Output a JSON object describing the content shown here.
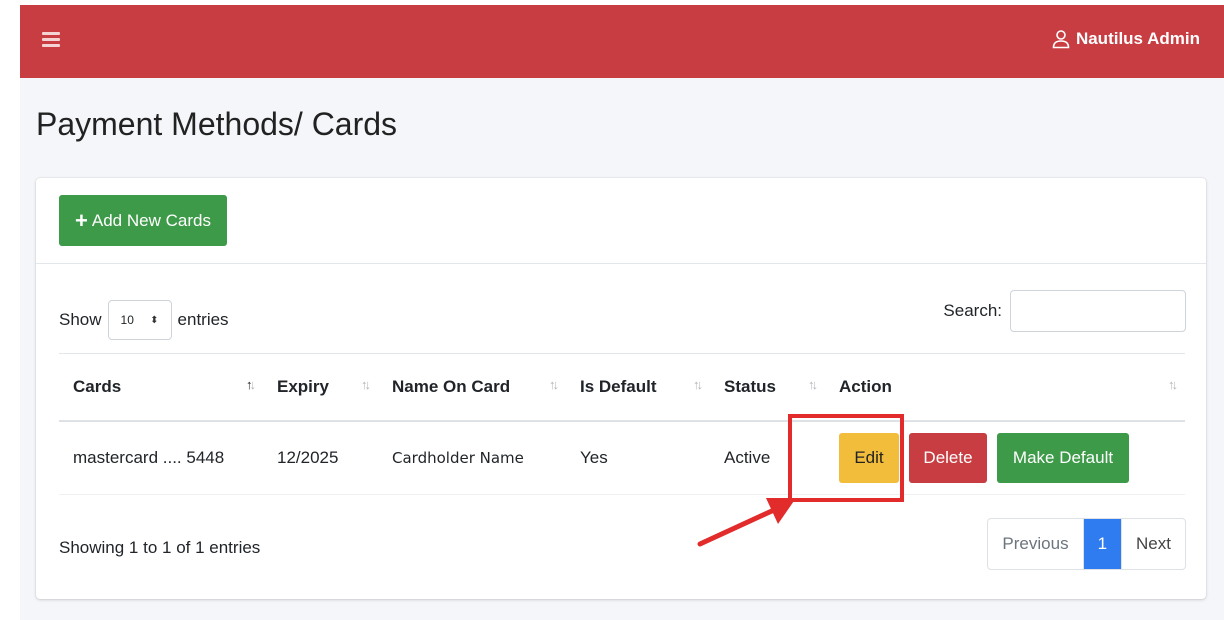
{
  "header": {
    "user_name": "Nautilus Admin",
    "bar_color": "#c73d42"
  },
  "page": {
    "title": "Payment Methods/ Cards"
  },
  "toolbar": {
    "add_label": "Add New Cards",
    "add_icon": "plus-icon"
  },
  "length": {
    "prefix": "Show",
    "value": "10",
    "suffix": "entries"
  },
  "search": {
    "label": "Search:",
    "value": ""
  },
  "table": {
    "columns": [
      "Cards",
      "Expiry",
      "Name On Card",
      "Is Default",
      "Status",
      "Action"
    ],
    "rows": [
      {
        "card": "mastercard .... 5448",
        "expiry": "12/2025",
        "name": "Cardholder Name",
        "is_default": "Yes",
        "status": "Active",
        "actions": {
          "edit": "Edit",
          "delete": "Delete",
          "make_default": "Make Default"
        }
      }
    ]
  },
  "footer": {
    "info": "Showing 1 to 1 of 1 entries",
    "pagination": {
      "previous": "Previous",
      "current": "1",
      "next": "Next"
    }
  },
  "colors": {
    "success": "#3d9a48",
    "danger": "#c73d42",
    "warning": "#f2bd3a",
    "primary": "#2f7bf0",
    "annotation": "#e22b2b"
  }
}
